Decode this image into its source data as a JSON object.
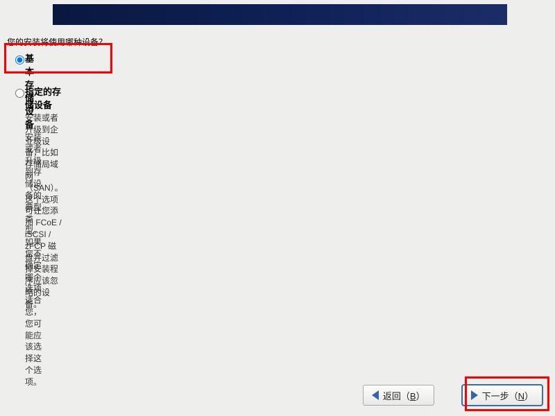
{
  "question": "您的安装将使用哪种设备？",
  "options": {
    "basic": {
      "title": "基本存储设备",
      "desc": "安装或者升级到存储设备的典型类型。如果您不确定哪个选项适合您，您可能应该选择这个选项。",
      "selected": true
    },
    "specified": {
      "title": "指定的存储设备",
      "desc": "安装或者升级到企业级设备，比如存储局域网（SAN）。这个选项可让您添加 FCoE / iSCSI / zFCP 磁盘并过滤掉安装程序应该忽略的设备。",
      "selected": false
    }
  },
  "buttons": {
    "back_prefix": "返回（",
    "back_mnemonic": "B",
    "back_suffix": "）",
    "next_prefix": "下一步（",
    "next_mnemonic": "N",
    "next_suffix": "）"
  }
}
